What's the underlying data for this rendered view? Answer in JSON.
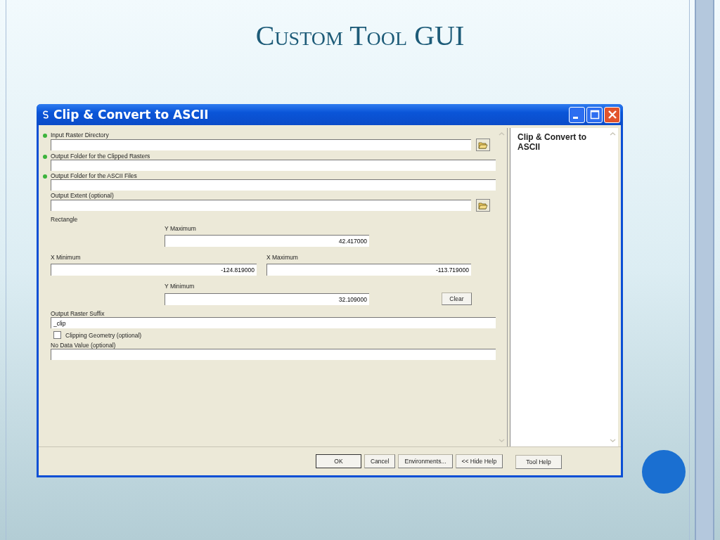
{
  "slide": {
    "title": "Custom Tool GUI"
  },
  "dialog": {
    "title": "Clip & Convert to ASCII",
    "parameters": [
      {
        "kind": "field",
        "label": "Input Raster Directory",
        "required": true,
        "browse": true
      },
      {
        "kind": "field",
        "label": "Output Folder for the Clipped Rasters",
        "required": true,
        "browse": false
      },
      {
        "kind": "field",
        "label": "Output Folder for the ASCII Files",
        "required": true,
        "browse": false
      },
      {
        "kind": "field",
        "label": "Output Extent (optional)",
        "required": false,
        "browse": true
      },
      {
        "kind": "extent",
        "label": "Rectangle",
        "y_max": {
          "label": "Y Maximum",
          "value": "42.417000"
        },
        "x_min": {
          "label": "X Minimum",
          "value": "-124.819000"
        },
        "x_max": {
          "label": "X Maximum",
          "value": "-113.719000"
        },
        "y_min": {
          "label": "Y Minimum",
          "value": "32.109000"
        },
        "clear": "Clear"
      },
      {
        "kind": "field",
        "label": "Output Raster Suffix",
        "required": false,
        "browse": false,
        "value": "_clip"
      },
      {
        "kind": "checkbox",
        "label": "Clipping Geometry (optional)",
        "checked": false
      },
      {
        "kind": "field",
        "label": "No Data Value (optional)",
        "required": false,
        "browse": false
      }
    ],
    "help": {
      "title": "Clip & Convert to ASCII"
    },
    "buttons": [
      "OK",
      "Cancel",
      "Environments...",
      "<< Hide Help"
    ],
    "help_button": "Tool Help"
  }
}
